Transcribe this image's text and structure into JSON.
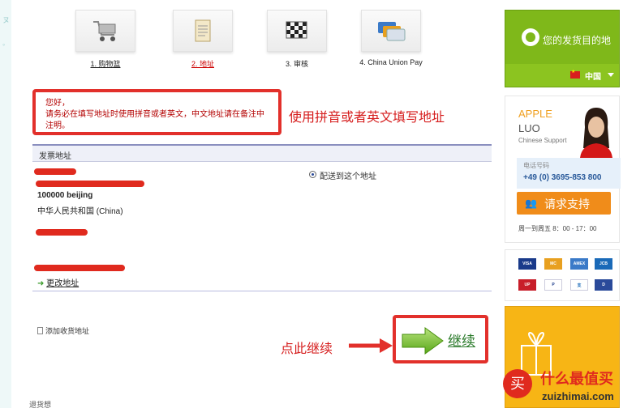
{
  "steps": [
    {
      "label": "1. 购物篮",
      "state": "done",
      "icon": "shopping-cart-icon"
    },
    {
      "label": "2. 地址",
      "state": "active",
      "icon": "clipboard-icon"
    },
    {
      "label": "3. 审核",
      "state": "pending",
      "icon": "checkered-flag-icon"
    },
    {
      "label": "4. China Union Pay",
      "state": "pending",
      "icon": "credit-cards-icon"
    }
  ],
  "notice": {
    "greeting": "您好，",
    "message": "请务必在填写地址时使用拼音或者英文，中文地址请在备注中注明。"
  },
  "annotations": {
    "notice": "使用拼音或者英文填写地址",
    "continue": "点此继续"
  },
  "billing": {
    "header": "发票地址",
    "postcode_city": "100000 beijing",
    "country": "中华人民共和国 (China)",
    "ship_option": "配送到这个地址",
    "change_link": "更改地址"
  },
  "add_shipping": "添加收货地址",
  "continue_label": "继续",
  "bottom_text": "退货想",
  "sidebar": {
    "destination_title": "您的发货目的地",
    "country": "中国",
    "agent_first": "APPLE",
    "agent_last": "LUO",
    "agent_role": "Chinese Support",
    "phone_label": "电话号码",
    "phone": "+49 (0) 3695-853 800",
    "request_button": "请求支持",
    "hours": "周一到周五 8：00 - 17：00",
    "payment_cards": [
      "VISA",
      "MasterCard",
      "AMEX",
      "JCB",
      "UnionPay",
      "PayPal",
      "支付宝",
      "Diners"
    ]
  },
  "watermark": {
    "cn": "什么最值买",
    "en": "zuizhimai.com",
    "badge": "买"
  },
  "colors": {
    "accent_red": "#e2302b",
    "green": "#7fb81a",
    "orange": "#f08c1a"
  }
}
